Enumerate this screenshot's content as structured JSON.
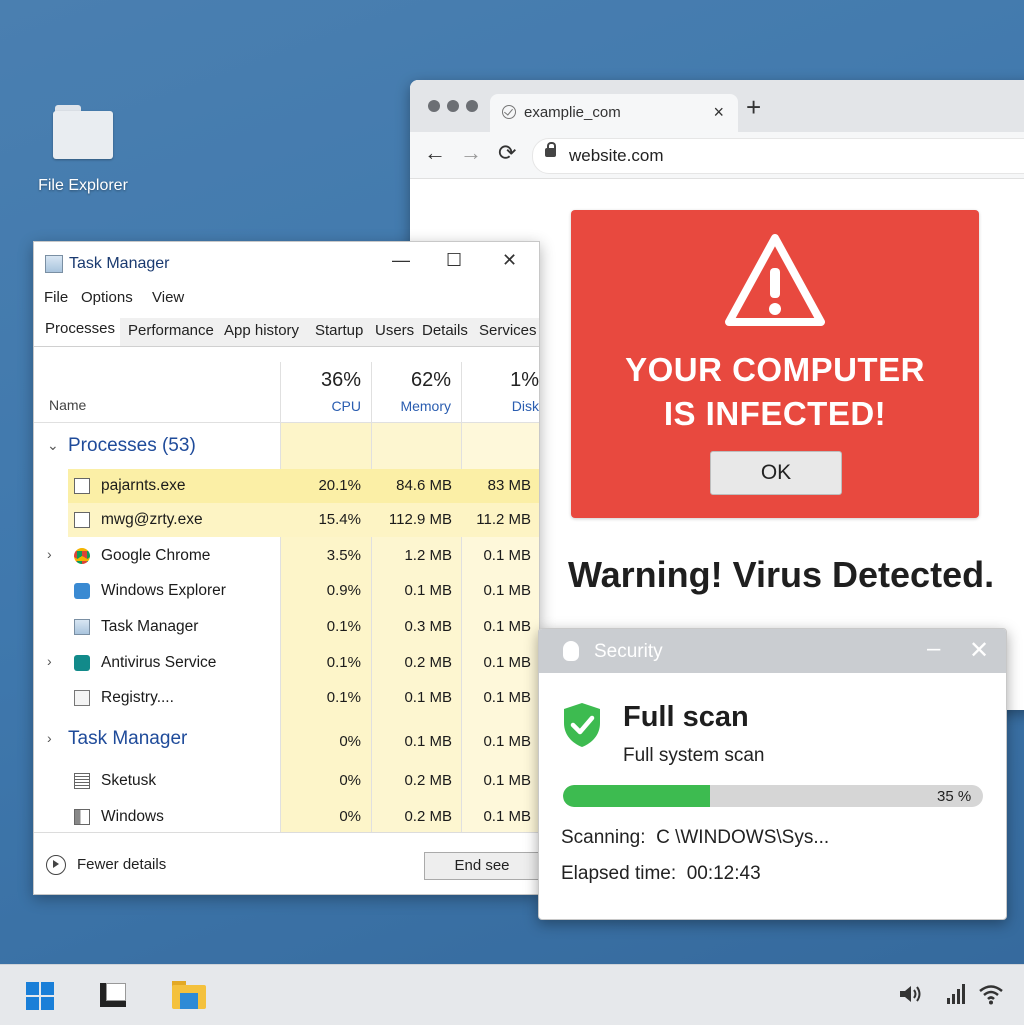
{
  "desktop": {
    "icon_label": "File Explorer"
  },
  "browser": {
    "tab_title": "examplie_com",
    "tab_close": "×",
    "new_tab": "+",
    "back": "←",
    "forward": "→",
    "reload": "⟳",
    "url": "website.com",
    "alert_line1": "YOUR COMPUTER",
    "alert_line2": "IS INFECTED!",
    "alert_ok": "OK",
    "warning": "Warning! Virus Detected."
  },
  "task_manager": {
    "title": "Task Manager",
    "window_controls": {
      "minimize": "—",
      "maximize": "☐",
      "close": "✕"
    },
    "menu": [
      "File",
      "Options",
      "View"
    ],
    "tabs": [
      "Processes",
      "Performance",
      "App history",
      "Startup",
      "Users",
      "Details",
      "Services"
    ],
    "name_header": "Name",
    "columns": [
      {
        "pct": "36%",
        "label": "CPU"
      },
      {
        "pct": "62%",
        "label": "Memory"
      },
      {
        "pct": "1%",
        "label": "Disk"
      }
    ],
    "group1": "Processes (53)",
    "rows": [
      {
        "name": "pajarnts.exe",
        "cpu": "20.1%",
        "mem": "84.6 MB",
        "disk": "83 MB"
      },
      {
        "name": "mwg@zrty.exe",
        "cpu": "15.4%",
        "mem": "112.9 MB",
        "disk": "11.2 MB"
      },
      {
        "name": "Google Chrome",
        "cpu": "3.5%",
        "mem": "1.2 MB",
        "disk": "0.1 MB"
      },
      {
        "name": "Windows Explorer",
        "cpu": "0.9%",
        "mem": "0.1 MB",
        "disk": "0.1 MB"
      },
      {
        "name": "Task Manager",
        "cpu": "0.1%",
        "mem": "0.3 MB",
        "disk": "0.1 MB"
      },
      {
        "name": "Antivirus Service",
        "cpu": "0.1%",
        "mem": "0.2 MB",
        "disk": "0.1 MB"
      },
      {
        "name": "Registry....",
        "cpu": "0.1%",
        "mem": "0.1 MB",
        "disk": "0.1 MB"
      },
      {
        "name": "Task Manager",
        "cpu": "0%",
        "mem": "0.1 MB",
        "disk": "0.1 MB"
      },
      {
        "name": "Sketusk",
        "cpu": "0%",
        "mem": "0.2 MB",
        "disk": "0.1 MB"
      },
      {
        "name": "Windows",
        "cpu": "0%",
        "mem": "0.2 MB",
        "disk": "0.1 MB"
      }
    ],
    "fewer_details": "Fewer details",
    "end_task": "End see"
  },
  "security": {
    "title": "Security",
    "minimize": "–",
    "close": "✕",
    "heading": "Full scan",
    "subheading": "Full system scan",
    "progress": 0.35,
    "progress_label": "35 %",
    "scanning_label": "Scanning:",
    "scanning_path": "C \\WINDOWS\\Sys...",
    "elapsed_label": "Elapsed time:",
    "elapsed_value": "00:12:43"
  },
  "taskbar": {
    "tray_icons": [
      "volume-icon",
      "signal-icon",
      "wifi-icon"
    ]
  },
  "colors": {
    "alert_red": "#e8493f",
    "progress_green": "#3dbb50",
    "highlight_yellow": "#fbeea2",
    "link_blue": "#1f4b9a"
  }
}
